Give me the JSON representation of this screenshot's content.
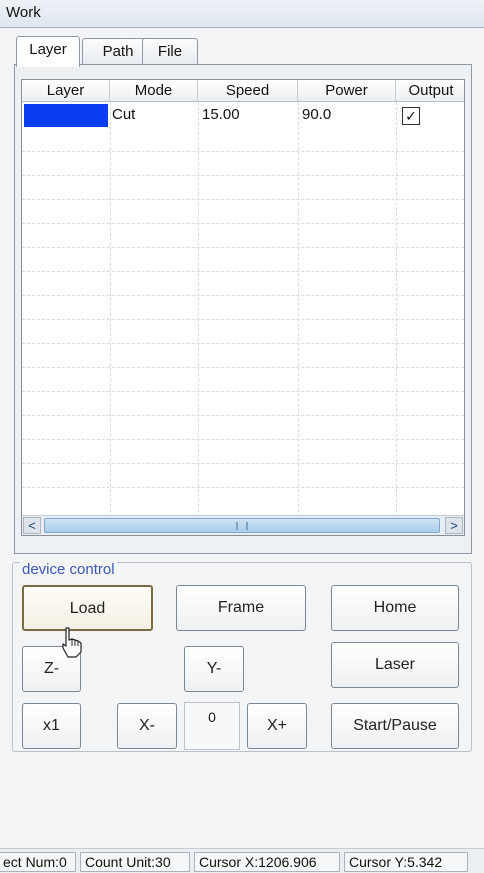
{
  "panel": {
    "title": "Work"
  },
  "tabs": [
    {
      "label": "Layer",
      "active": true
    },
    {
      "label": "Path",
      "active": false
    },
    {
      "label": "File",
      "active": false
    }
  ],
  "layer_table": {
    "columns": [
      "Layer",
      "Mode",
      "Speed",
      "Power",
      "Output"
    ],
    "rows": [
      {
        "layer_color": "#0a3ef0",
        "mode": "Cut",
        "speed": "15.00",
        "power": "90.0",
        "output_checked": true
      }
    ]
  },
  "device_control": {
    "label": "device control",
    "buttons": {
      "load": "Load",
      "frame": "Frame",
      "home": "Home",
      "z_minus": "Z-",
      "y_minus": "Y-",
      "laser": "Laser",
      "x1": "x1",
      "x_minus": "X-",
      "x_plus": "X+",
      "start_pause": "Start/Pause"
    },
    "step_value": "0"
  },
  "statusbar": {
    "select_num": "ect Num:0",
    "count_unit": "Count Unit:30",
    "cursor_x": "Cursor X:1206.906",
    "cursor_y": "Cursor Y:5.342"
  },
  "colors": {
    "accent": "#3b57b5",
    "layer_blue": "#0a3ef0"
  }
}
